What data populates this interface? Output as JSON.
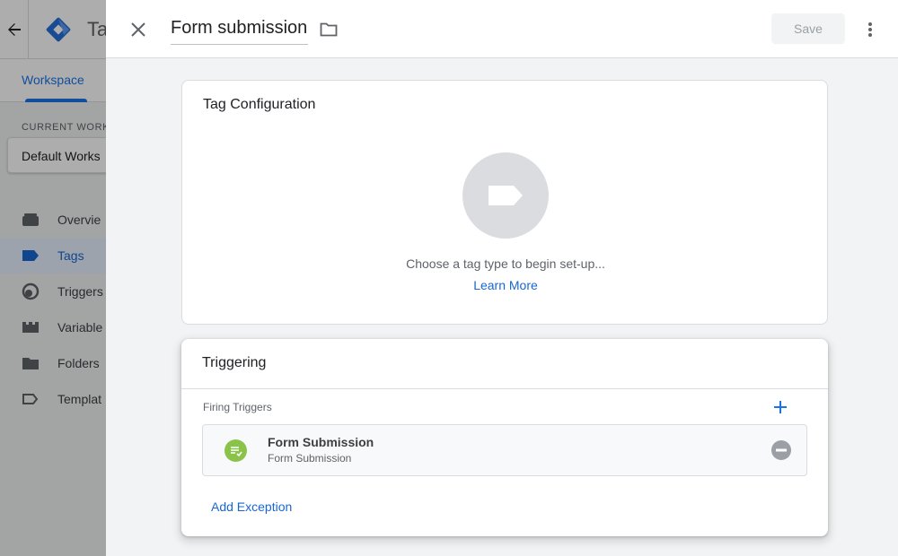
{
  "background": {
    "app_title": "Ta",
    "workspace_tab": "Workspace",
    "current_workspace_label": "CURRENT WORKS",
    "workspace_name": "Default Works",
    "nav": [
      {
        "label": "Overvie",
        "icon": "overview-icon"
      },
      {
        "label": "Tags",
        "icon": "tag-icon",
        "active": true
      },
      {
        "label": "Triggers",
        "icon": "trigger-icon"
      },
      {
        "label": "Variable",
        "icon": "variable-icon"
      },
      {
        "label": "Folders",
        "icon": "folder-icon"
      },
      {
        "label": "Templat",
        "icon": "template-icon"
      }
    ]
  },
  "panel": {
    "title": "Form submission",
    "save_label": "Save",
    "tag_configuration": {
      "title": "Tag Configuration",
      "hint": "Choose a tag type to begin set-up...",
      "learn_more": "Learn More"
    },
    "triggering": {
      "title": "Triggering",
      "firing_label": "Firing Triggers",
      "trigger": {
        "name": "Form Submission",
        "type": "Form Submission"
      },
      "add_exception": "Add Exception"
    }
  },
  "colors": {
    "accent": "#1a73e8",
    "trigger_green": "#8bc34a",
    "disabled_text": "#9aa0a6"
  }
}
